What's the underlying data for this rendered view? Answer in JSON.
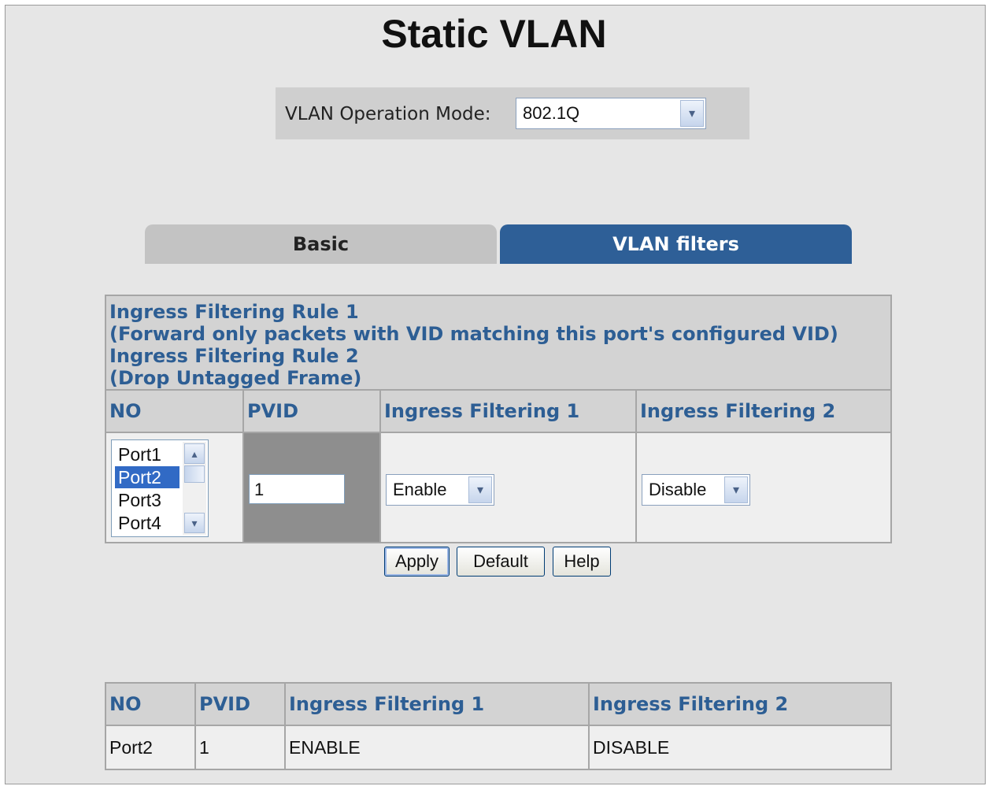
{
  "page": {
    "title": "Static VLAN"
  },
  "mode": {
    "label": "VLAN Operation Mode:",
    "value": "802.1Q"
  },
  "tabs": [
    {
      "label": "Basic",
      "active": false
    },
    {
      "label": "VLAN filters",
      "active": true
    }
  ],
  "rules": {
    "line1": "Ingress Filtering Rule 1",
    "line2": "(Forward only packets with VID matching this port's configured VID)",
    "line3": "Ingress Filtering Rule 2",
    "line4": "(Drop Untagged Frame)"
  },
  "config": {
    "headers": [
      "NO",
      "PVID",
      "Ingress Filtering 1",
      "Ingress Filtering 2"
    ],
    "ports": [
      "Port1",
      "Port2",
      "Port3",
      "Port4"
    ],
    "selected_port": "Port2",
    "pvid": "1",
    "filter1": "Enable",
    "filter2": "Disable"
  },
  "buttons": {
    "apply": "Apply",
    "default": "Default",
    "help": "Help"
  },
  "summary": {
    "headers": [
      "NO",
      "PVID",
      "Ingress Filtering 1",
      "Ingress Filtering 2"
    ],
    "row": [
      "Port2",
      "1",
      "ENABLE",
      "DISABLE"
    ]
  },
  "colors": {
    "accent": "#2e5f97",
    "header_text": "#2d5e94",
    "selection": "#316ac5"
  }
}
